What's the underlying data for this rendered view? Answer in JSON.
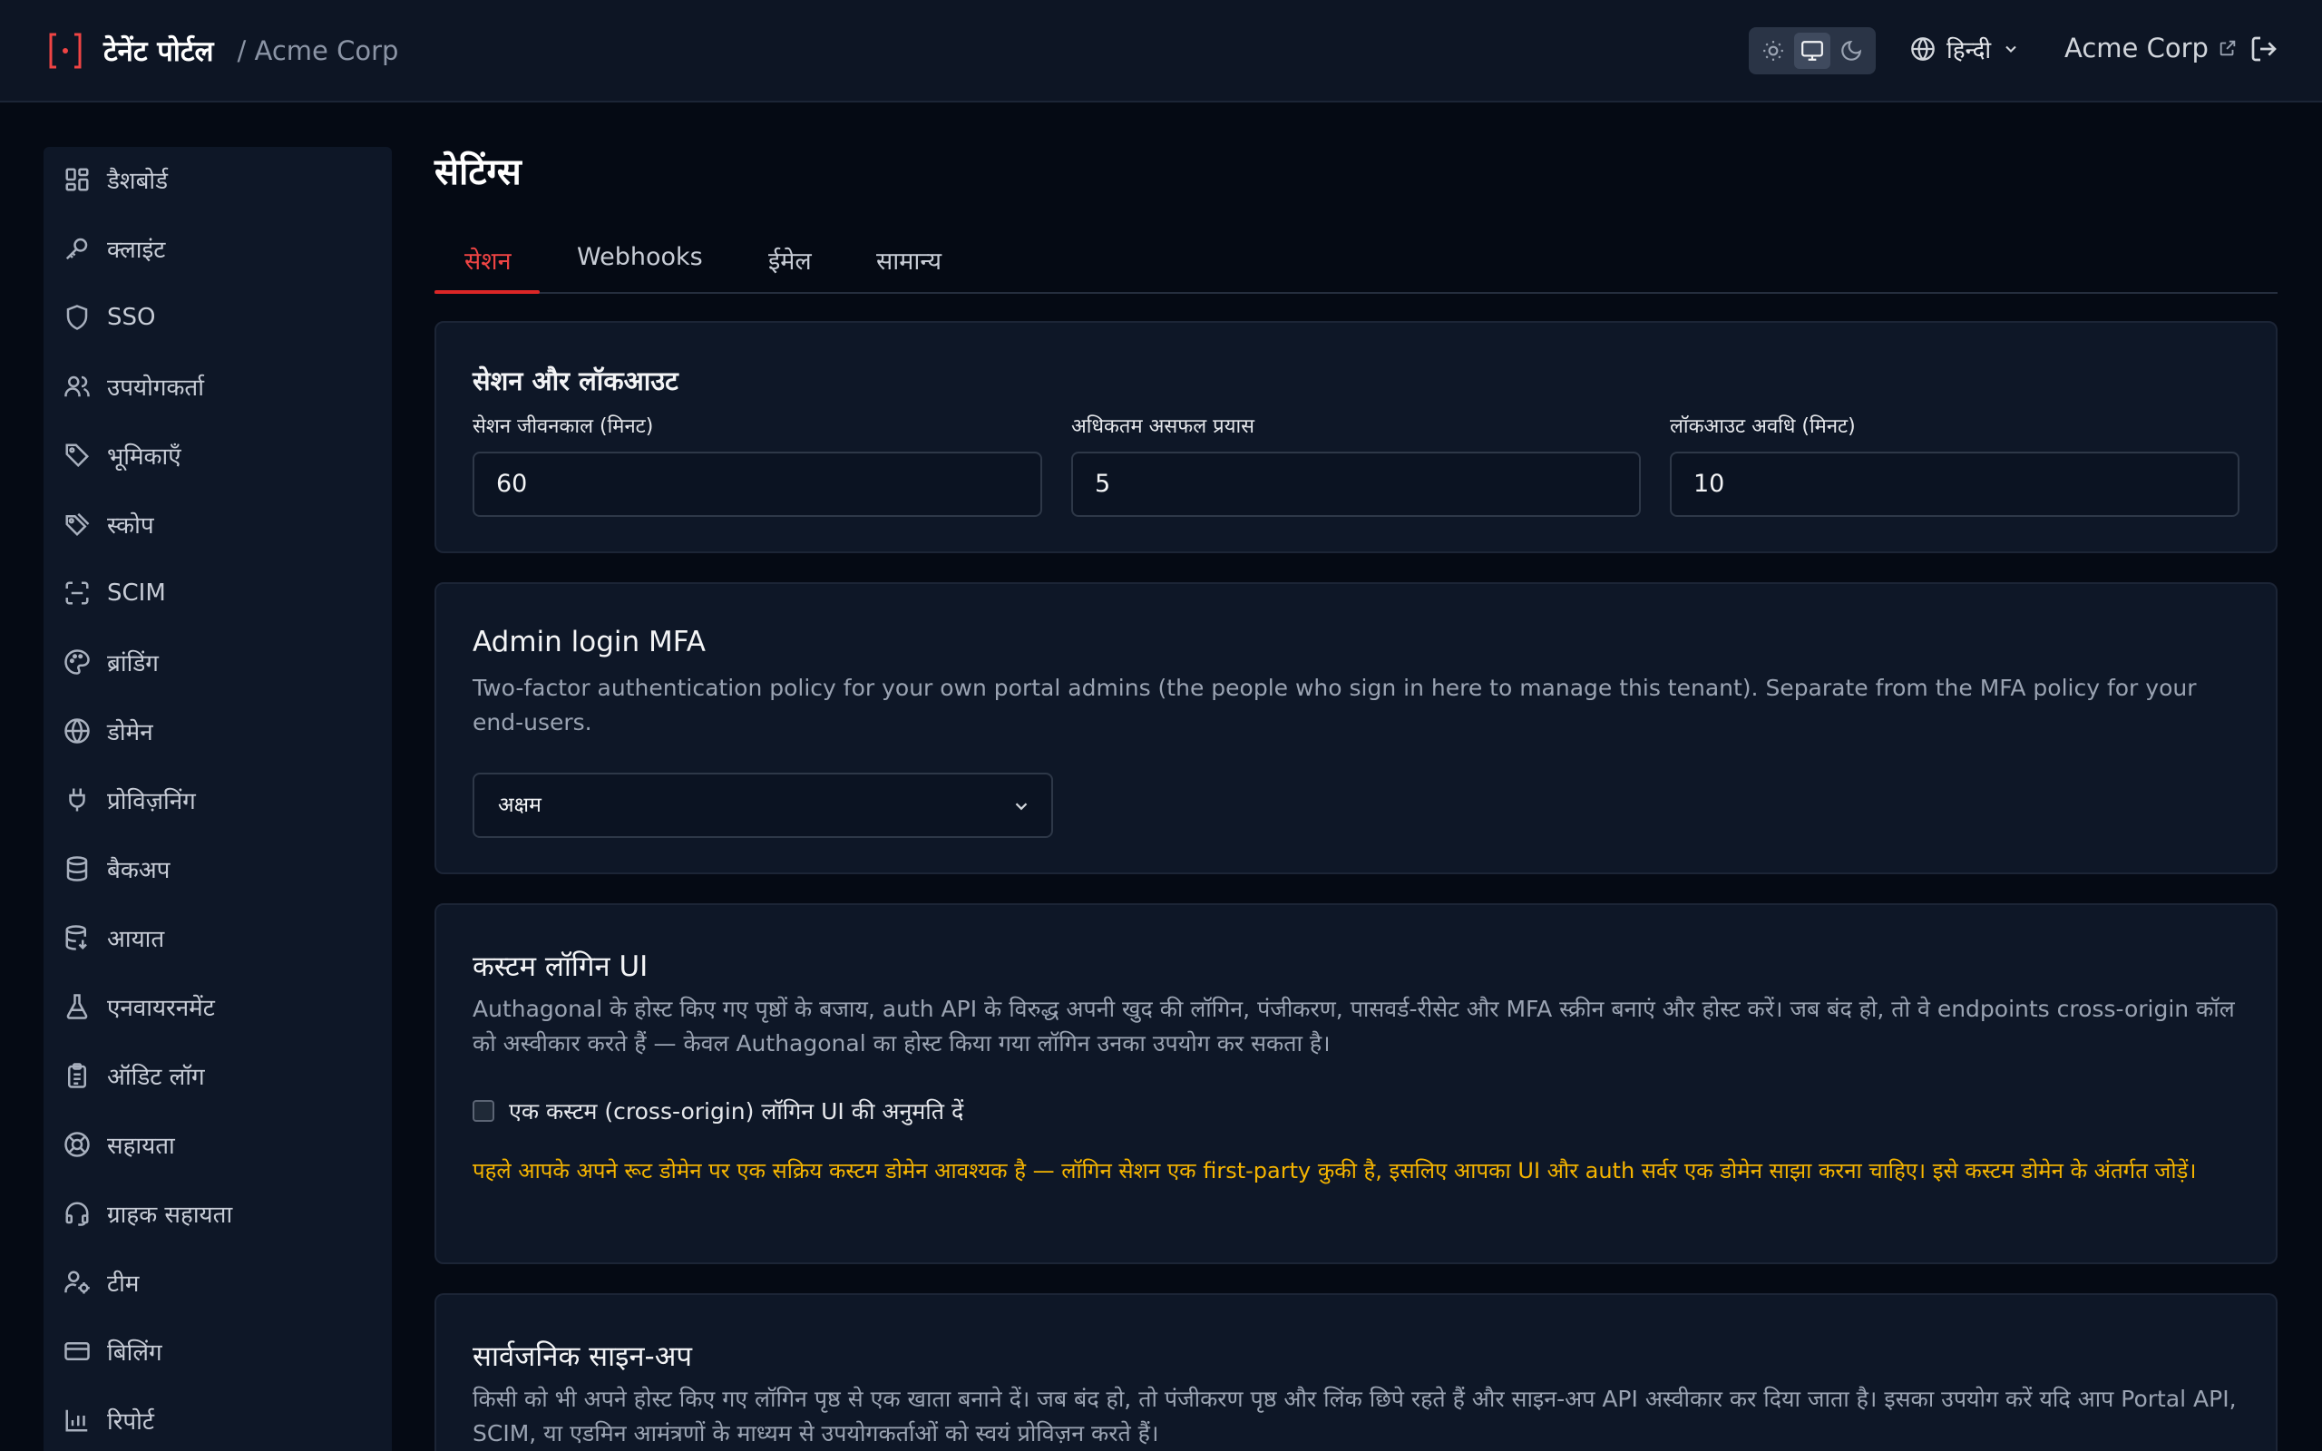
{
  "header": {
    "brand_name": "टेनेंट पोर्टल",
    "tenant": "/ Acme Corp",
    "language": "हिन्दी",
    "tenant_link": "Acme Corp"
  },
  "sidebar": {
    "items": [
      {
        "label": "डैशबोर्ड",
        "icon": "dashboard-icon"
      },
      {
        "label": "क्लाइंट",
        "icon": "key-icon"
      },
      {
        "label": "SSO",
        "icon": "shield-icon"
      },
      {
        "label": "उपयोगकर्ता",
        "icon": "users-icon"
      },
      {
        "label": "भूमिकाएँ",
        "icon": "tag-icon"
      },
      {
        "label": "स्कोप",
        "icon": "tags-icon"
      },
      {
        "label": "SCIM",
        "icon": "scan-icon"
      },
      {
        "label": "ब्रांडिंग",
        "icon": "palette-icon"
      },
      {
        "label": "डोमेन",
        "icon": "globe-icon"
      },
      {
        "label": "प्रोविज़निंग",
        "icon": "plug-icon"
      },
      {
        "label": "बैकअप",
        "icon": "database-icon"
      },
      {
        "label": "आयात",
        "icon": "database-import-icon"
      },
      {
        "label": "एनवायरनमेंट",
        "icon": "flask-icon"
      },
      {
        "label": "ऑडिट लॉग",
        "icon": "clipboard-icon"
      },
      {
        "label": "सहायता",
        "icon": "lifebuoy-icon"
      },
      {
        "label": "ग्राहक सहायता",
        "icon": "headset-icon"
      },
      {
        "label": "टीम",
        "icon": "user-gear-icon"
      },
      {
        "label": "बिलिंग",
        "icon": "credit-card-icon"
      },
      {
        "label": "रिपोर्ट",
        "icon": "bar-chart-icon"
      }
    ]
  },
  "main": {
    "title": "सेटिंग्स",
    "tabs": [
      {
        "label": "सेशन",
        "active": true
      },
      {
        "label": "Webhooks",
        "active": false
      },
      {
        "label": "ईमेल",
        "active": false
      },
      {
        "label": "सामान्य",
        "active": false
      }
    ],
    "session": {
      "title": "सेशन और लॉकआउट",
      "fields": [
        {
          "label": "सेशन जीवनकाल (मिनट)",
          "value": "60"
        },
        {
          "label": "अधिकतम असफल प्रयास",
          "value": "5"
        },
        {
          "label": "लॉकआउट अवधि (मिनट)",
          "value": "10"
        }
      ]
    },
    "mfa": {
      "title": "Admin login MFA",
      "description": "Two-factor authentication policy for your own portal admins (the people who sign in here to manage this tenant). Separate from the MFA policy for your end-users.",
      "selected": "अक्षम"
    },
    "custom_login": {
      "title": "कस्टम लॉगिन UI",
      "description": "Authagonal के होस्ट किए गए पृष्ठों के बजाय, auth API के विरुद्ध अपनी खुद की लॉगिन, पंजीकरण, पासवर्ड-रीसेट और MFA स्क्रीन बनाएं और होस्ट करें। जब बंद हो, तो वे endpoints cross-origin कॉल को अस्वीकार करते हैं — केवल Authagonal का होस्ट किया गया लॉगिन उनका उपयोग कर सकता है।",
      "checkbox_label": "एक कस्टम (cross-origin) लॉगिन UI की अनुमति दें",
      "warning": "पहले आपके अपने रूट डोमेन पर एक सक्रिय कस्टम डोमेन आवश्यक है — लॉगिन सेशन एक first-party कुकी है, इसलिए आपका UI और auth सर्वर एक डोमेन साझा करना चाहिए। इसे कस्टम डोमेन के अंतर्गत जोड़ें।"
    },
    "signup": {
      "title": "सार्वजनिक साइन-अप",
      "description": "किसी को भी अपने होस्ट किए गए लॉगिन पृष्ठ से एक खाता बनाने दें। जब बंद हो, तो पंजीकरण पृष्ठ और लिंक छिपे रहते हैं और साइन-अप API अस्वीकार कर दिया जाता है। इसका उपयोग करें यदि आप Portal API, SCIM, या एडमिन आमंत्रणों के माध्यम से उपयोगकर्ताओं को स्वयं प्रोविज़न करते हैं।"
    }
  },
  "colors": {
    "accent": "#dc2626",
    "warning": "#f5b400",
    "background": "#050a14",
    "card": "#0e1727"
  }
}
